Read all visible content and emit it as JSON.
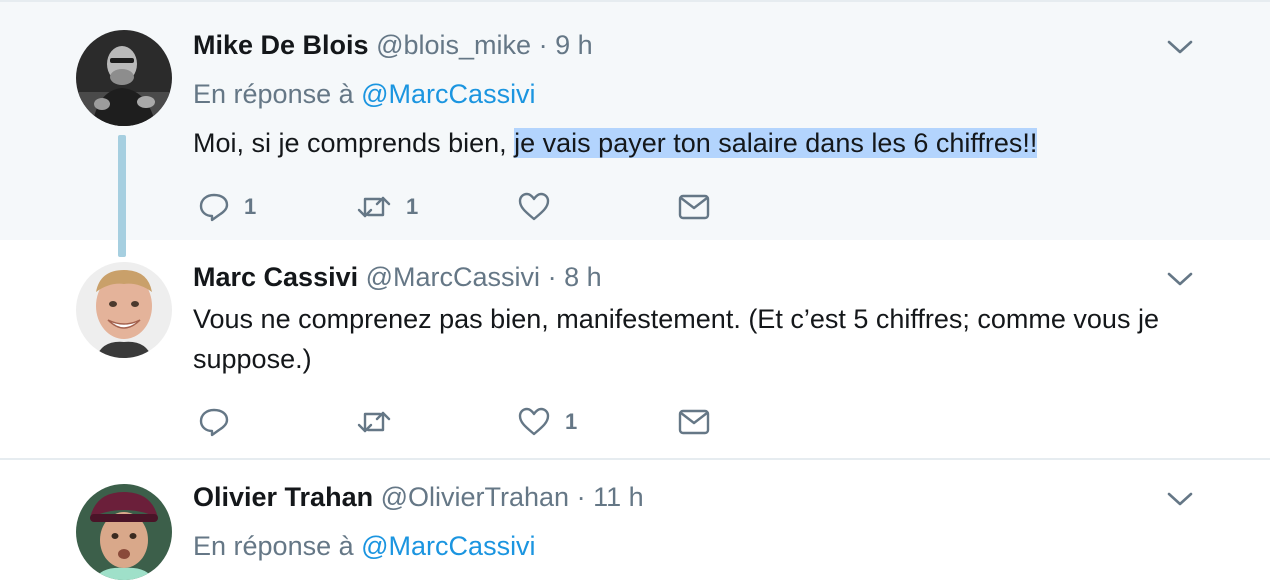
{
  "tweets": [
    {
      "fullname": "Mike De Blois",
      "handle": "@blois_mike",
      "separator": "·",
      "time": "9 h",
      "reply_prefix": "En réponse à",
      "reply_mention": "@MarcCassivi",
      "text_plain": "Moi, si je comprends bien, ",
      "text_highlighted": "je vais payer ton salaire dans les 6 chiffres!!",
      "reply_count": "1",
      "retweet_count": "1",
      "like_count": "",
      "avatar_icon": "avatar-photo-icon"
    },
    {
      "fullname": "Marc Cassivi",
      "handle": "@MarcCassivi",
      "separator": "·",
      "time": "8 h",
      "text": "Vous ne comprenez pas bien, manifestement. (Et c’est 5 chiffres; comme vous je suppose.)",
      "reply_count": "",
      "retweet_count": "",
      "like_count": "1",
      "avatar_icon": "avatar-photo-icon"
    },
    {
      "fullname": "Olivier Trahan",
      "handle": "@OlivierTrahan",
      "separator": "·",
      "time": "11 h",
      "reply_prefix": "En réponse à",
      "reply_mention": "@MarcCassivi",
      "avatar_icon": "avatar-photo-icon"
    }
  ],
  "colors": {
    "highlighted_bg": "#f5f8fa",
    "thread_line": "#a6cfe0",
    "link": "#1b95e0",
    "muted": "#657786",
    "icon": "#657786",
    "selection": "#b3d4fd"
  },
  "icons": [
    "chevron-down-icon",
    "reply-icon",
    "retweet-icon",
    "like-icon",
    "message-icon"
  ]
}
